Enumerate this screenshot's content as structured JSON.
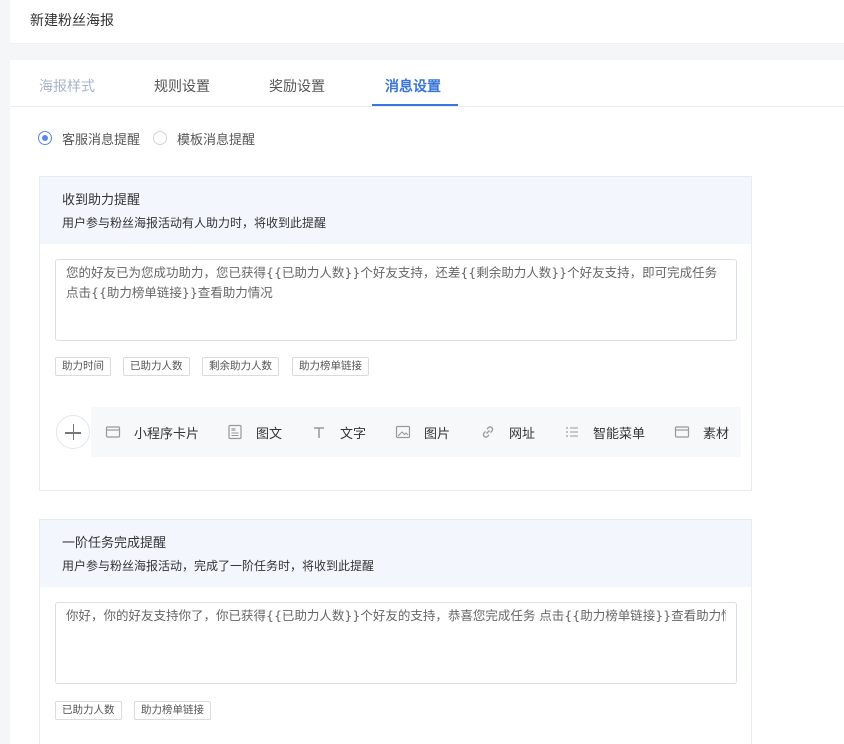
{
  "header": {
    "title": "新建粉丝海报"
  },
  "tabs": [
    {
      "label": "海报样式",
      "state": "disabled"
    },
    {
      "label": "规则设置",
      "state": "normal"
    },
    {
      "label": "奖励设置",
      "state": "normal"
    },
    {
      "label": "消息设置",
      "state": "active"
    }
  ],
  "message_type": {
    "options": [
      {
        "label": "客服消息提醒",
        "checked": true
      },
      {
        "label": "模板消息提醒",
        "checked": false
      }
    ]
  },
  "cards": [
    {
      "title": "收到助力提醒",
      "description": "用户参与粉丝海报活动有人助力时，将收到此提醒",
      "content_lines": [
        "您的好友已为您成功助力，您已获得{{已助力人数}}个好友支持，还差{{剩余助力人数}}个好友支持，即可完成任务",
        "点击{{助力榜单链接}}查看助力情况"
      ],
      "tags": [
        "助力时间",
        "已助力人数",
        "剩余助力人数",
        "助力榜单链接"
      ],
      "toolbar": [
        {
          "label": "小程序卡片",
          "icon": "mini-program-card-icon"
        },
        {
          "label": "图文",
          "icon": "article-icon"
        },
        {
          "label": "文字",
          "icon": "text-icon"
        },
        {
          "label": "图片",
          "icon": "image-icon"
        },
        {
          "label": "网址",
          "icon": "link-icon"
        },
        {
          "label": "智能菜单",
          "icon": "menu-list-icon"
        },
        {
          "label": "素材",
          "icon": "material-icon"
        }
      ]
    },
    {
      "title": "一阶任务完成提醒",
      "description": "用户参与粉丝海报活动，完成了一阶任务时，将收到此提醒",
      "content_lines": [
        "你好，你的好友支持你了，你已获得{{已助力人数}}个好友的支持，恭喜您完成任务 点击{{助力榜单链接}}查看助力情况"
      ],
      "tags": [
        "已助力人数",
        "助力榜单链接"
      ]
    }
  ],
  "colors": {
    "accent": "#3a75d9",
    "radio": "#5b86e5",
    "card_head_bg": "#f3f7fd"
  }
}
